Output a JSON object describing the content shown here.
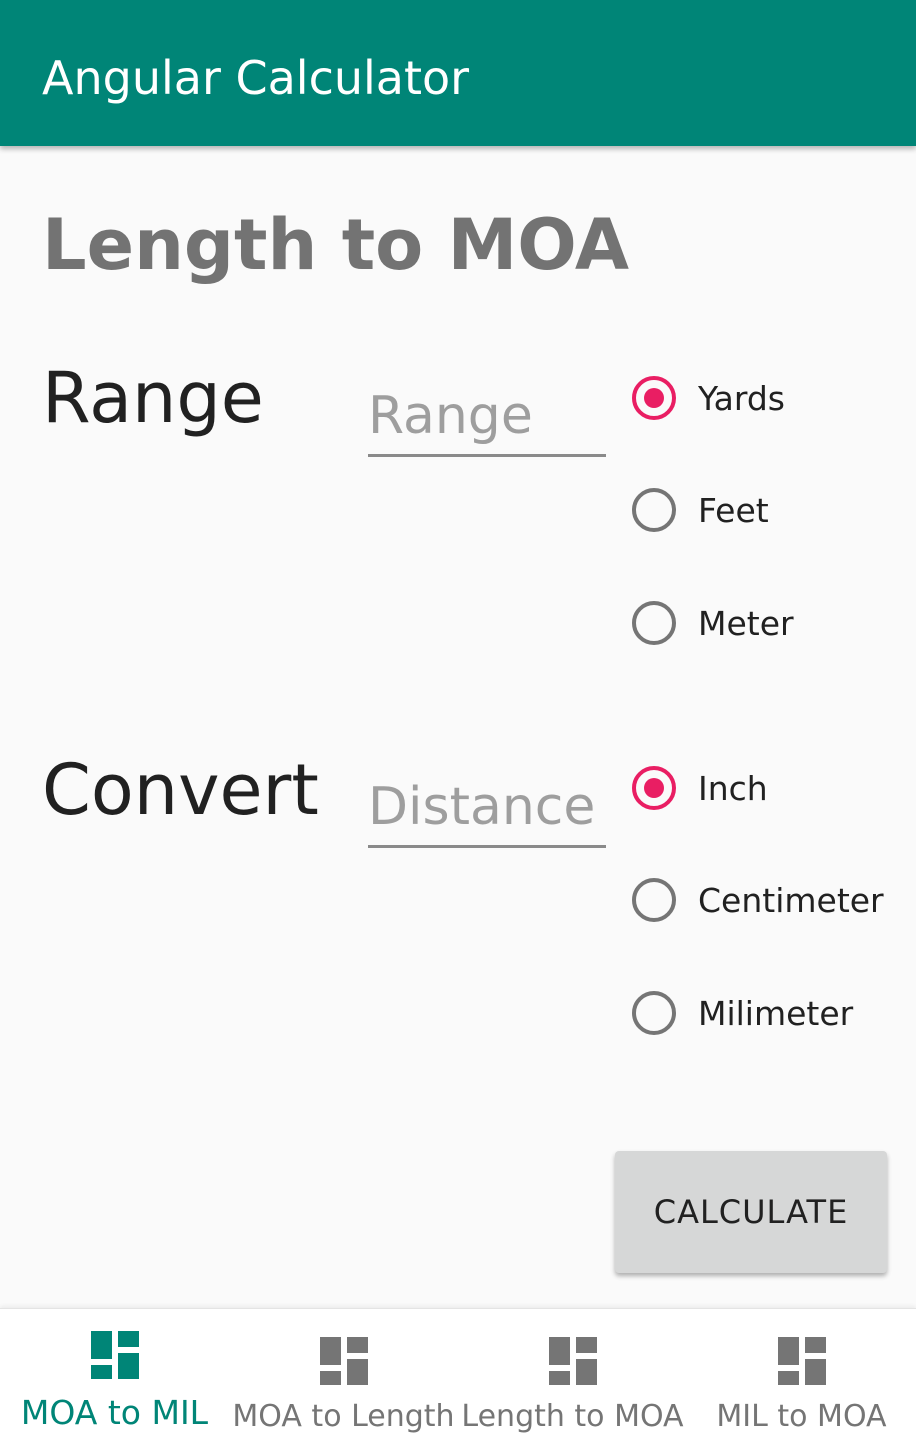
{
  "toolbar": {
    "title": "Angular Calculator",
    "color": "#008577"
  },
  "page": {
    "title": "Length to MOA"
  },
  "range": {
    "label": "Range",
    "placeholder": "Range",
    "value": "",
    "options": [
      {
        "label": "Yards",
        "checked": true
      },
      {
        "label": "Feet",
        "checked": false
      },
      {
        "label": "Meter",
        "checked": false
      }
    ]
  },
  "convert": {
    "label": "Convert",
    "placeholder": "Distance",
    "value": "",
    "options": [
      {
        "label": "Inch",
        "checked": true
      },
      {
        "label": "Centimeter",
        "checked": false
      },
      {
        "label": "Milimeter",
        "checked": false
      }
    ]
  },
  "button": {
    "calculate_label": "CALCULATE"
  },
  "bottom_nav": {
    "items": [
      {
        "label": "MOA to MIL",
        "icon": "dashboard-icon",
        "active": true
      },
      {
        "label": "MOA to Length",
        "icon": "dashboard-icon",
        "active": false
      },
      {
        "label": "Length to MOA",
        "icon": "dashboard-icon",
        "active": false
      },
      {
        "label": "MIL to MOA",
        "icon": "dashboard-icon",
        "active": false
      }
    ]
  },
  "colors": {
    "primary": "#008577",
    "accent": "#e91e63",
    "title_gray": "#737373"
  }
}
